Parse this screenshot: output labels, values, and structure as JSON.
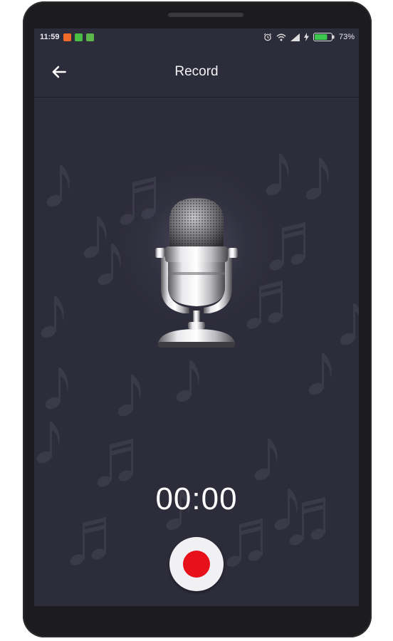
{
  "status_bar": {
    "time": "11:59",
    "battery": "73%",
    "notification_icons": [
      "mi-notification-icon",
      "battery-saver-notification-icon",
      "android-notification-icon"
    ]
  },
  "app_bar": {
    "title": "Record",
    "back_icon": "arrow-left-icon"
  },
  "recorder": {
    "elapsed": "00:00",
    "state": "idle",
    "record_button_icon": "record-dot-icon"
  },
  "colors": {
    "screen_background": "#2d2c3a",
    "record_red": "#e8101a",
    "record_button_bg": "#f1f1f3",
    "battery_green": "#3cc84e"
  }
}
